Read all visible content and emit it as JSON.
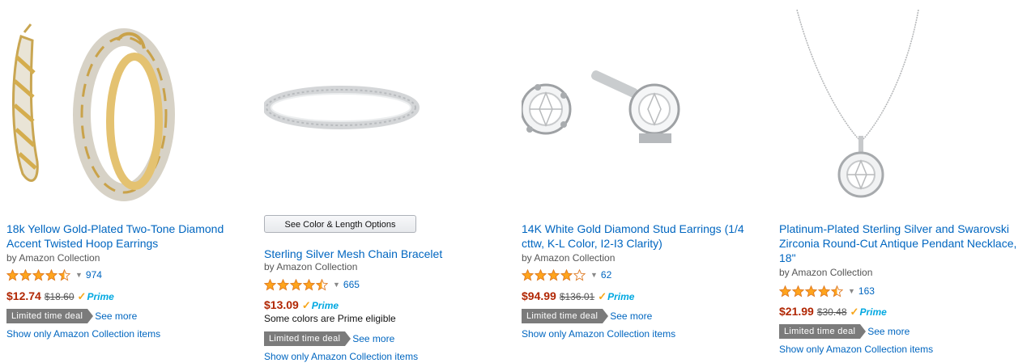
{
  "products": [
    {
      "title": "18k Yellow Gold-Plated Two-Tone Diamond Accent Twisted Hoop Earrings",
      "byline": "by Amazon Collection",
      "rating": 4.5,
      "review_count": "974",
      "price": "$12.74",
      "list_price": "$18.60",
      "prime": "Prime",
      "deal_badge": "Limited time deal",
      "see_more": "See more",
      "show_only": "Show only Amazon Collection items",
      "image_icon": "hoop-earrings-image"
    },
    {
      "options_button": "See Color & Length Options",
      "title": "Sterling Silver Mesh Chain Bracelet",
      "byline": "by Amazon Collection",
      "rating": 4.5,
      "review_count": "665",
      "price": "$13.09",
      "prime": "Prime",
      "colors_note": "Some colors are Prime eligible",
      "deal_badge": "Limited time deal",
      "see_more": "See more",
      "show_only": "Show only Amazon Collection items",
      "image_icon": "mesh-bracelet-image"
    },
    {
      "title": "14K White Gold Diamond Stud Earrings (1/4 cttw, K-L Color, I2-I3 Clarity)",
      "byline": "by Amazon Collection",
      "rating": 4,
      "review_count": "62",
      "price": "$94.99",
      "list_price": "$136.01",
      "prime": "Prime",
      "deal_badge": "Limited time deal",
      "see_more": "See more",
      "show_only": "Show only Amazon Collection items",
      "image_icon": "stud-earrings-image"
    },
    {
      "title": "Platinum-Plated Sterling Silver and Swarovski Zirconia Round-Cut Antique Pendant Necklace, 18\"",
      "byline": "by Amazon Collection",
      "rating": 4.5,
      "review_count": "163",
      "price": "$21.99",
      "list_price": "$30.48",
      "prime": "Prime",
      "deal_badge": "Limited time deal",
      "see_more": "See more",
      "show_only": "Show only Amazon Collection items",
      "image_icon": "pendant-necklace-image"
    }
  ],
  "colors": {
    "link": "#0066c0",
    "price": "#b12704",
    "star": "#ffa41c",
    "prime": "#00a8e1",
    "badge": "#7b7b7b"
  }
}
